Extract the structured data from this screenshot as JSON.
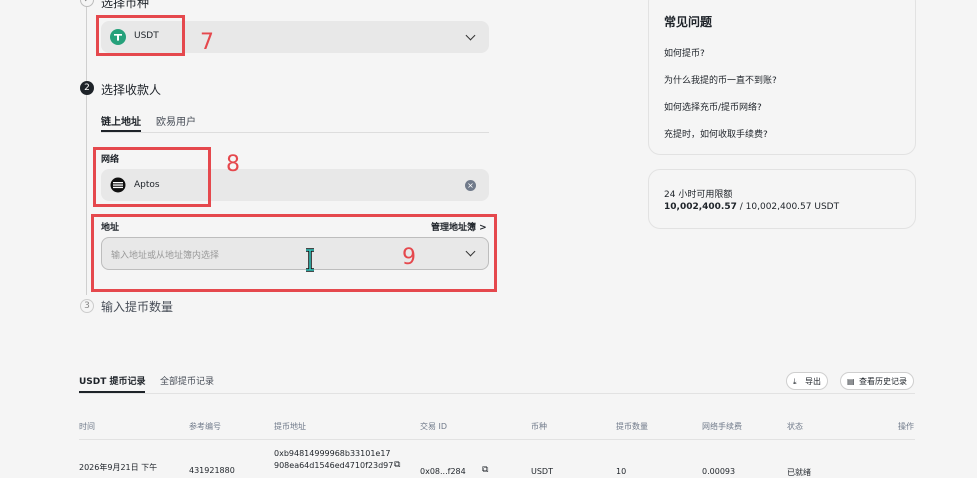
{
  "steps": {
    "step1": {
      "title": "选择币种"
    },
    "step2": {
      "number": "2",
      "title": "选择收款人"
    },
    "step3": {
      "number": "3",
      "title": "输入提币数量"
    }
  },
  "coin_select": {
    "value": "USDT"
  },
  "recipient_tabs": [
    {
      "label": "链上地址",
      "active": true
    },
    {
      "label": "欧易用户",
      "active": false
    }
  ],
  "network": {
    "label": "网络",
    "value": "Aptos"
  },
  "address": {
    "label": "地址",
    "manage_label": "管理地址簿",
    "placeholder": "输入地址或从地址簿内选择"
  },
  "annotations": {
    "n7": "7",
    "n8": "8",
    "n9": "9"
  },
  "faq": {
    "title": "常见问题",
    "items": [
      "如何提币?",
      "为什么我提的币一直不到账?",
      "如何选择充币/提币网络?",
      "充提时，如何收取手续费?"
    ]
  },
  "limit": {
    "title": "24 小时可用限额",
    "used": "10,002,400.57",
    "separator": " / ",
    "total": "10,002,400.57 USDT"
  },
  "records": {
    "tabs": [
      {
        "label": "USDT 提币记录",
        "active": true
      },
      {
        "label": "全部提币记录",
        "active": false
      }
    ],
    "export_label": "导出",
    "history_label": "查看历史记录",
    "columns": [
      "时间",
      "参考编号",
      "提币地址",
      "交易 ID",
      "币种",
      "提币数量",
      "网络手续费",
      "状态",
      "操作"
    ],
    "rows": [
      {
        "time": "2026年9月21日 下午",
        "ref": "431921880",
        "address_line1": "0xb94814999968b33101e17",
        "address_line2": "908ea64d1546ed4710f23d97",
        "txid": "0x08...f284",
        "coin": "USDT",
        "amount": "10",
        "fee": "0.00093",
        "status": "已就绪"
      }
    ]
  },
  "colors": {
    "accent": "#1e2329",
    "annotation": "#e5484d",
    "usdt": "#26a17b"
  }
}
